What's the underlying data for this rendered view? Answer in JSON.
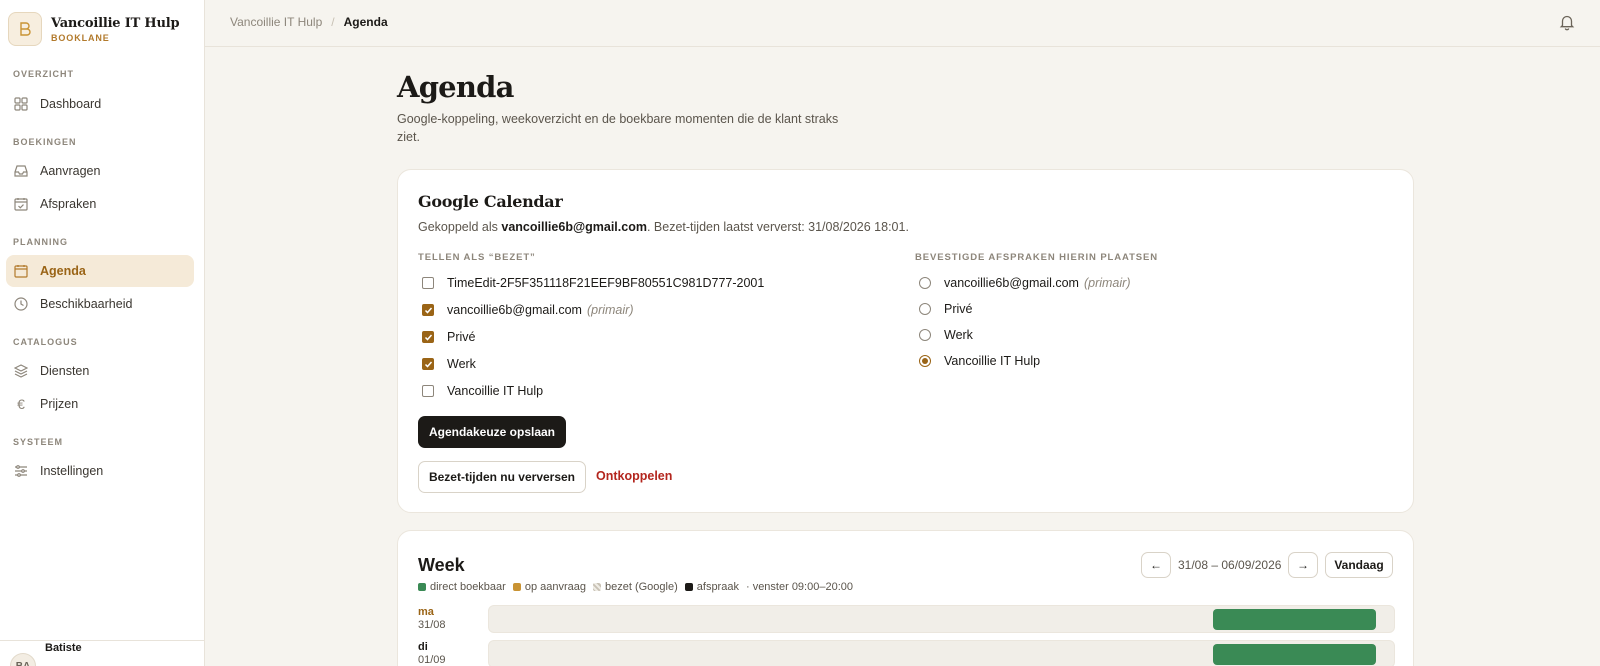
{
  "brand": {
    "name": "Vancoillie IT Hulp",
    "sub": "BOOKLANE"
  },
  "sidebar": {
    "sections": [
      {
        "label": "OVERZICHT",
        "items": [
          {
            "label": "Dashboard",
            "icon": "grid-icon"
          }
        ]
      },
      {
        "label": "BOEKINGEN",
        "items": [
          {
            "label": "Aanvragen",
            "icon": "inbox-icon"
          },
          {
            "label": "Afspraken",
            "icon": "calendar-check-icon"
          }
        ]
      },
      {
        "label": "PLANNING",
        "items": [
          {
            "label": "Agenda",
            "icon": "calendar-icon",
            "active": true
          },
          {
            "label": "Beschikbaarheid",
            "icon": "clock-icon"
          }
        ]
      },
      {
        "label": "CATALOGUS",
        "items": [
          {
            "label": "Diensten",
            "icon": "layers-icon"
          },
          {
            "label": "Prijzen",
            "icon": "euro-icon"
          }
        ]
      },
      {
        "label": "SYSTEEM",
        "items": [
          {
            "label": "Instellingen",
            "icon": "sliders-icon"
          }
        ]
      }
    ],
    "user": {
      "initials": "BA",
      "name": "Batiste"
    }
  },
  "topbar": {
    "parent": "Vancoillie IT Hulp",
    "separator": "/",
    "current": "Agenda"
  },
  "page": {
    "title": "Agenda",
    "description": "Google-koppeling, weekoverzicht en de boekbare momenten die de klant straks ziet."
  },
  "google": {
    "title": "Google Calendar",
    "linked_prefix": "Gekoppeld als ",
    "linked_email": "vancoillie6b@gmail.com",
    "linked_suffix": ". Bezet-tijden laatst ververst: 31/08/2026 18:01.",
    "busy_heading": "TELLEN ALS “BEZET”",
    "busy_calendars": [
      {
        "label": "TimeEdit-2F5F351118F21EEF9BF80551C981D777-2001",
        "note": "",
        "checked": false
      },
      {
        "label": "vancoillie6b@gmail.com",
        "note": "(primair)",
        "checked": true
      },
      {
        "label": "Privé",
        "note": "",
        "checked": true
      },
      {
        "label": "Werk",
        "note": "",
        "checked": true
      },
      {
        "label": "Vancoillie IT Hulp",
        "note": "",
        "checked": false
      }
    ],
    "target_heading": "BEVESTIGDE AFSPRAKEN HIERIN PLAATSEN",
    "target_calendars": [
      {
        "label": "vancoillie6b@gmail.com",
        "note": "(primair)",
        "selected": false
      },
      {
        "label": "Privé",
        "note": "",
        "selected": false
      },
      {
        "label": "Werk",
        "note": "",
        "selected": false
      },
      {
        "label": "Vancoillie IT Hulp",
        "note": "",
        "selected": true
      }
    ],
    "save_label": "Agendakeuze opslaan",
    "refresh_label": "Bezet-tijden nu verversen",
    "disconnect_label": "Ontkoppelen"
  },
  "week": {
    "title": "Week",
    "legend": [
      {
        "label": "direct boekbaar",
        "color": "#3a8a55"
      },
      {
        "label": "op aanvraag",
        "color": "#c99333"
      },
      {
        "label": "bezet (Google)",
        "color": "#c8c2b5"
      },
      {
        "label": "afspraak",
        "color": "#1c1a17"
      }
    ],
    "window": "· venster 09:00–20:00",
    "prev_icon": "arrow-left-icon",
    "next_icon": "arrow-right-icon",
    "range": "31/08 – 06/09/2026",
    "today_label": "Vandaag",
    "days": [
      {
        "name": "ma",
        "date": "31/08",
        "today": true,
        "slots": [
          {
            "kind": "direct",
            "start": 0.8,
            "end": 0.98,
            "color": "#3a8a55"
          }
        ]
      },
      {
        "name": "di",
        "date": "01/09",
        "today": false,
        "slots": [
          {
            "kind": "direct",
            "start": 0.8,
            "end": 0.98,
            "color": "#3a8a55"
          }
        ]
      }
    ]
  },
  "colors": {
    "accent": "#9a6416",
    "accent_bg": "#f5ead8",
    "danger": "#b3261e",
    "dark": "#1c1a17"
  }
}
